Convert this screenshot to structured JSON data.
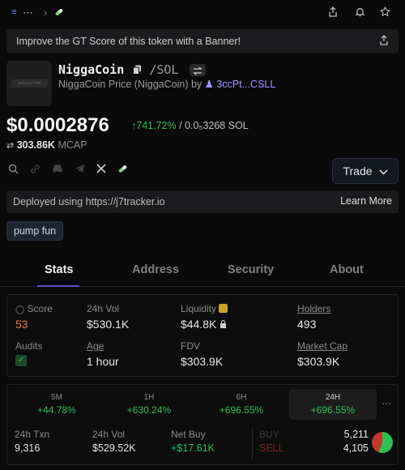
{
  "topbar": {
    "menu_icon": "menu-icon",
    "dots": "⋯",
    "chevron": "›",
    "pill": "pill-icon"
  },
  "banner": {
    "text": "Improve the GT Score of this token with a Banner!"
  },
  "token": {
    "logo_text": "NIGGACOIN",
    "name": "NiggaCoin",
    "pair": "/SOL",
    "subtitle": "NiggaCoin Price (NiggaCoin) by",
    "creator": "3ccPt...CSLL"
  },
  "price": {
    "value": "$0.0002876",
    "change": "↑741.72%",
    "sol_price": "/ 0.0₅3268 SOL",
    "mcap_value": "303.86K",
    "mcap_label": "MCAP"
  },
  "actions": {
    "trade": "Trade"
  },
  "deploy": {
    "text": "Deployed using https://j7tracker.io",
    "learn_more": "Learn More"
  },
  "tags": [
    "pump fun"
  ],
  "tabs": [
    "Stats",
    "Address",
    "Security",
    "About"
  ],
  "stats": {
    "score_label": "Score",
    "score_value": "53",
    "vol_label": "24h Vol",
    "vol_value": "$530.1K",
    "liq_label": "Liquidity",
    "liq_value": "$44.8K",
    "holders_label": "Holders",
    "holders_value": "493",
    "audits_label": "Audits",
    "age_label": "Age",
    "age_value": "1 hour",
    "fdv_label": "FDV",
    "fdv_value": "$303.9K",
    "mcap_label": "Market Cap",
    "mcap_value": "$303.9K"
  },
  "timeframes": [
    {
      "label": "5M",
      "value": "+44.78%"
    },
    {
      "label": "1H",
      "value": "+630.24%"
    },
    {
      "label": "6H",
      "value": "+696.55%"
    },
    {
      "label": "24H",
      "value": "+696.55%"
    }
  ],
  "txn": {
    "txn_label": "24h Txn",
    "txn_value": "9,316",
    "vol_label": "24h Vol",
    "vol_value": "$529.52K",
    "netbuy_label": "Net Buy",
    "netbuy_value": "+$17.61K",
    "buy_label": "BUY",
    "buy_value": "5,211",
    "sell_label": "SELL",
    "sell_value": "4,105"
  },
  "colors": {
    "accent": "#5c4fbf",
    "positive": "#2fbf57",
    "negative": "#e0413a",
    "score": "#e07a3a"
  }
}
